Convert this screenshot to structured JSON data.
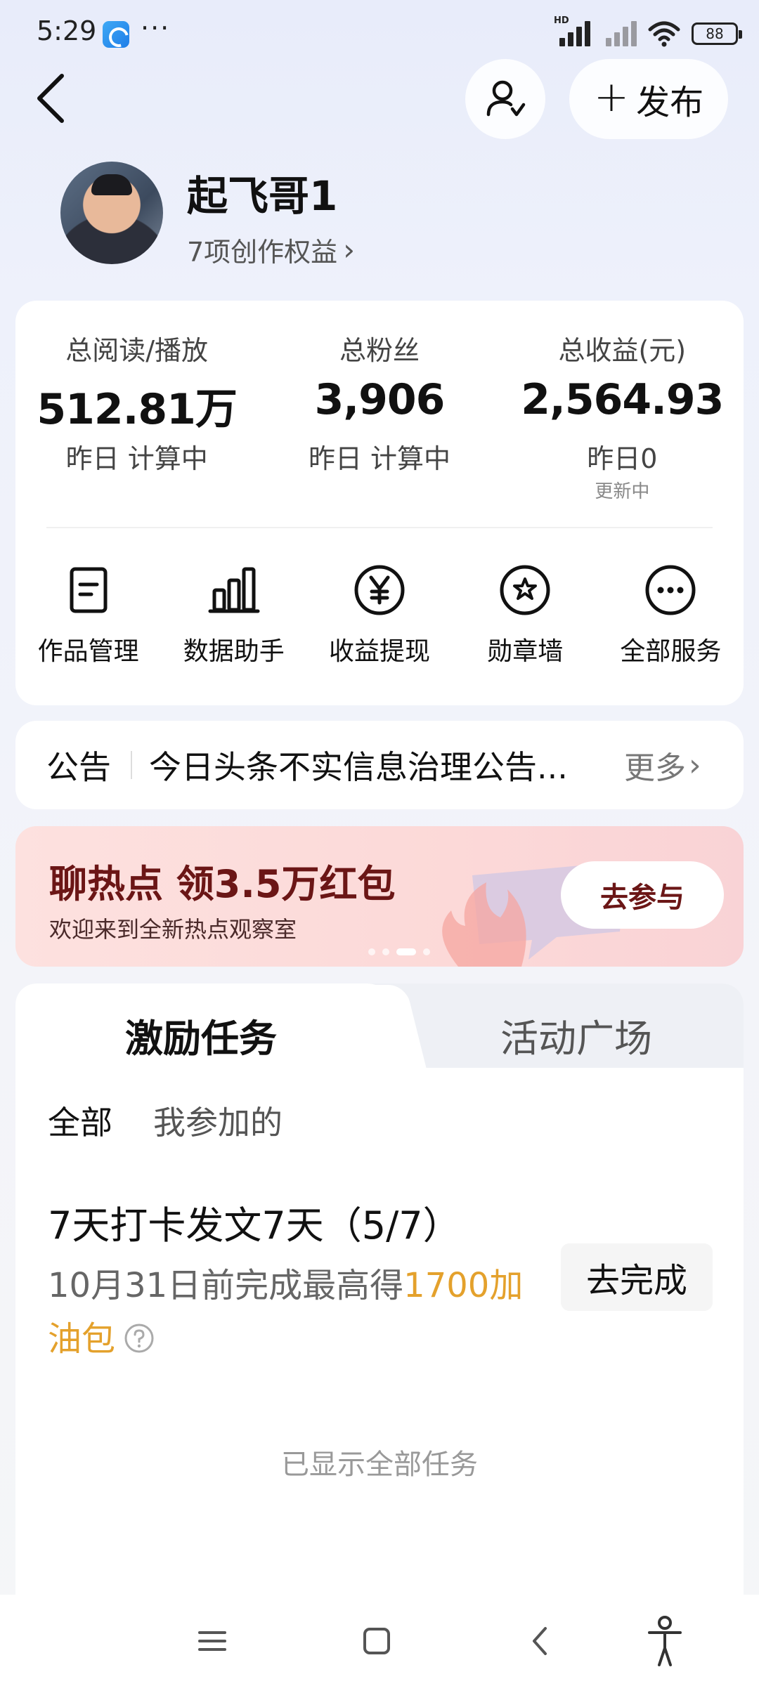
{
  "status_bar": {
    "time": "5:29",
    "more": "···",
    "hd": "HD",
    "battery": "88"
  },
  "header": {
    "publish_label": "发布",
    "publish_plus": "+"
  },
  "profile": {
    "username": "起飞哥1",
    "benefits": "7项创作权益",
    "chevron": "›"
  },
  "stats": [
    {
      "label": "总阅读/播放",
      "value": "512.81万",
      "sub": "昨日 计算中",
      "sub2": ""
    },
    {
      "label": "总粉丝",
      "value": "3,906",
      "sub": "昨日 计算中",
      "sub2": ""
    },
    {
      "label": "总收益(元)",
      "value": "2,564.93",
      "sub": "昨日0",
      "sub2": "更新中"
    }
  ],
  "services": [
    {
      "label": "作品管理",
      "icon": "document-icon"
    },
    {
      "label": "数据助手",
      "icon": "bar-chart-icon"
    },
    {
      "label": "收益提现",
      "icon": "yen-icon"
    },
    {
      "label": "勋章墙",
      "icon": "medal-star-icon"
    },
    {
      "label": "全部服务",
      "icon": "more-dots-icon"
    }
  ],
  "notice": {
    "title": "公告",
    "text": "今日头条不实信息治理公告...",
    "more": "更多",
    "chevron": "›"
  },
  "banner": {
    "title": "聊热点 领3.5万红包",
    "subtitle": "欢迎来到全新热点观察室",
    "button": "去参与",
    "page_count": 4,
    "active_page": 3
  },
  "tasks": {
    "tabs": [
      "激励任务",
      "活动广场"
    ],
    "active_tab": 0,
    "filters": [
      "全部",
      "我参加的"
    ],
    "active_filter": 0,
    "items": [
      {
        "title": "7天打卡发文7天（5/7）",
        "desc_prefix": "10月31日前完成最高得",
        "desc_highlight": "1700加油包",
        "button": "去完成"
      }
    ],
    "footer": "已显示全部任务"
  },
  "colors": {
    "highlight": "#e4a12c",
    "banner_text": "#6b1616",
    "background": "#eef1fb"
  }
}
